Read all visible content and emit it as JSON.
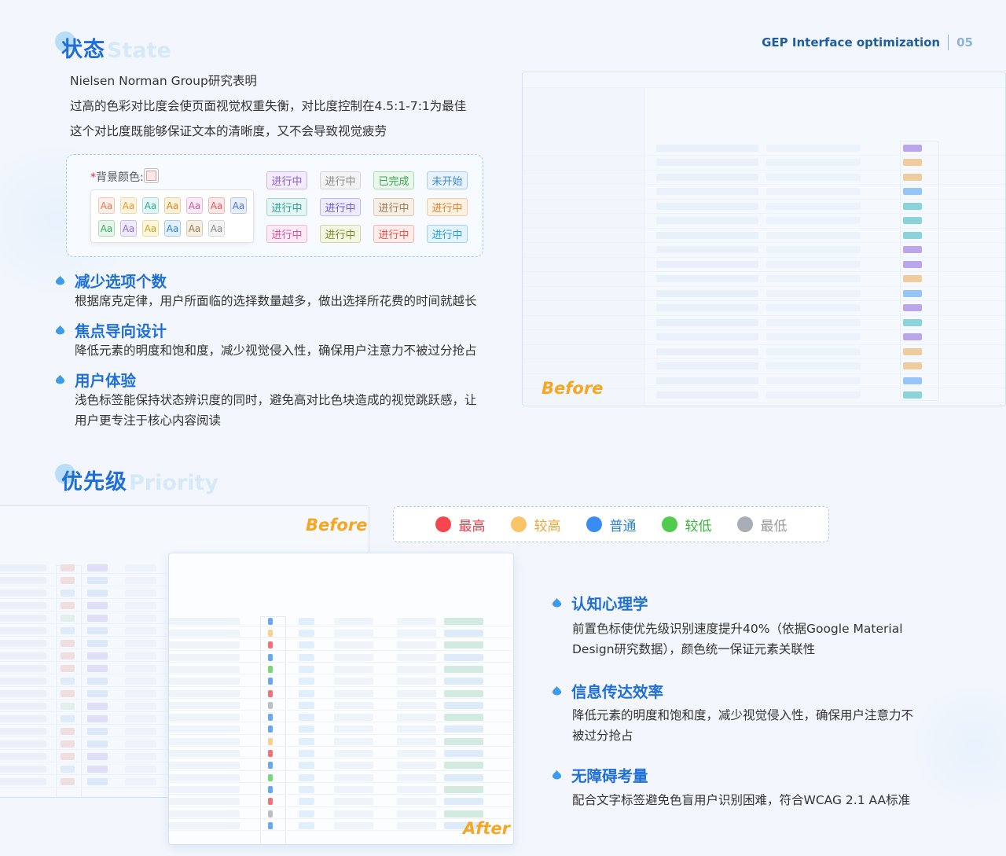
{
  "header": {
    "brand": "GEP Interface optimization",
    "page": "05"
  },
  "section1": {
    "title_cn": "状态",
    "title_en": "State",
    "intro": [
      "Nielsen Norman Group研究表明",
      "过高的色彩对比度会使页面视觉权重失衡，对比度控制在4.5:1-7:1为最佳",
      "这个对比度既能够保证文本的清晰度，又不会导致视觉疲劳"
    ],
    "palette": {
      "label": "背景颜色:",
      "required_mark": "*",
      "swatch_sample": "Aa",
      "tags": [
        "进行中",
        "进行中",
        "已完成",
        "未开始",
        "进行中",
        "进行中",
        "进行中",
        "进行中",
        "进行中",
        "进行中",
        "进行中",
        "进行中"
      ]
    },
    "points": [
      {
        "heading": "减少选项个数",
        "body": "根据席克定律，用户所面临的选择数量越多，做出选择所花费的时间就越长"
      },
      {
        "heading": "焦点导向设计",
        "body": "降低元素的明度和饱和度，减少视觉侵入性，确保用户注意力不被过分抢占"
      },
      {
        "heading": "用户体验",
        "body_lines": [
          "浅色标签能保持状态辨识度的同时，避免高对比色块造成的视觉跳跃感，让",
          "用户更专注于核心内容阅读"
        ]
      }
    ],
    "screenshot_label": "Before"
  },
  "section2": {
    "title_cn": "优先级",
    "title_en": "Priority",
    "before_label": "Before",
    "after_label": "After",
    "legend": [
      {
        "label": "最高",
        "color": "#f5454f"
      },
      {
        "label": "较高",
        "color": "#fbc36a"
      },
      {
        "label": "普通",
        "color": "#3a8df0"
      },
      {
        "label": "较低",
        "color": "#4fcc4e"
      },
      {
        "label": "最低",
        "color": "#a9aeb5"
      }
    ],
    "points": [
      {
        "heading": "认知心理学",
        "body_lines": [
          "前置色标使优先级识别速度提升40%（依据Google Material",
          "Design研究数据），颜色统一保证元素关联性"
        ]
      },
      {
        "heading": "信息传达效率",
        "body_lines": [
          "降低元素的明度和饱和度，减少视觉侵入性，确保用户注意力不",
          "被过分抢占"
        ]
      },
      {
        "heading": "无障碍考量",
        "body_lines": [
          "配合文字标签避免色盲用户识别困难，符合WCAG 2.1 AA标准"
        ]
      }
    ]
  }
}
